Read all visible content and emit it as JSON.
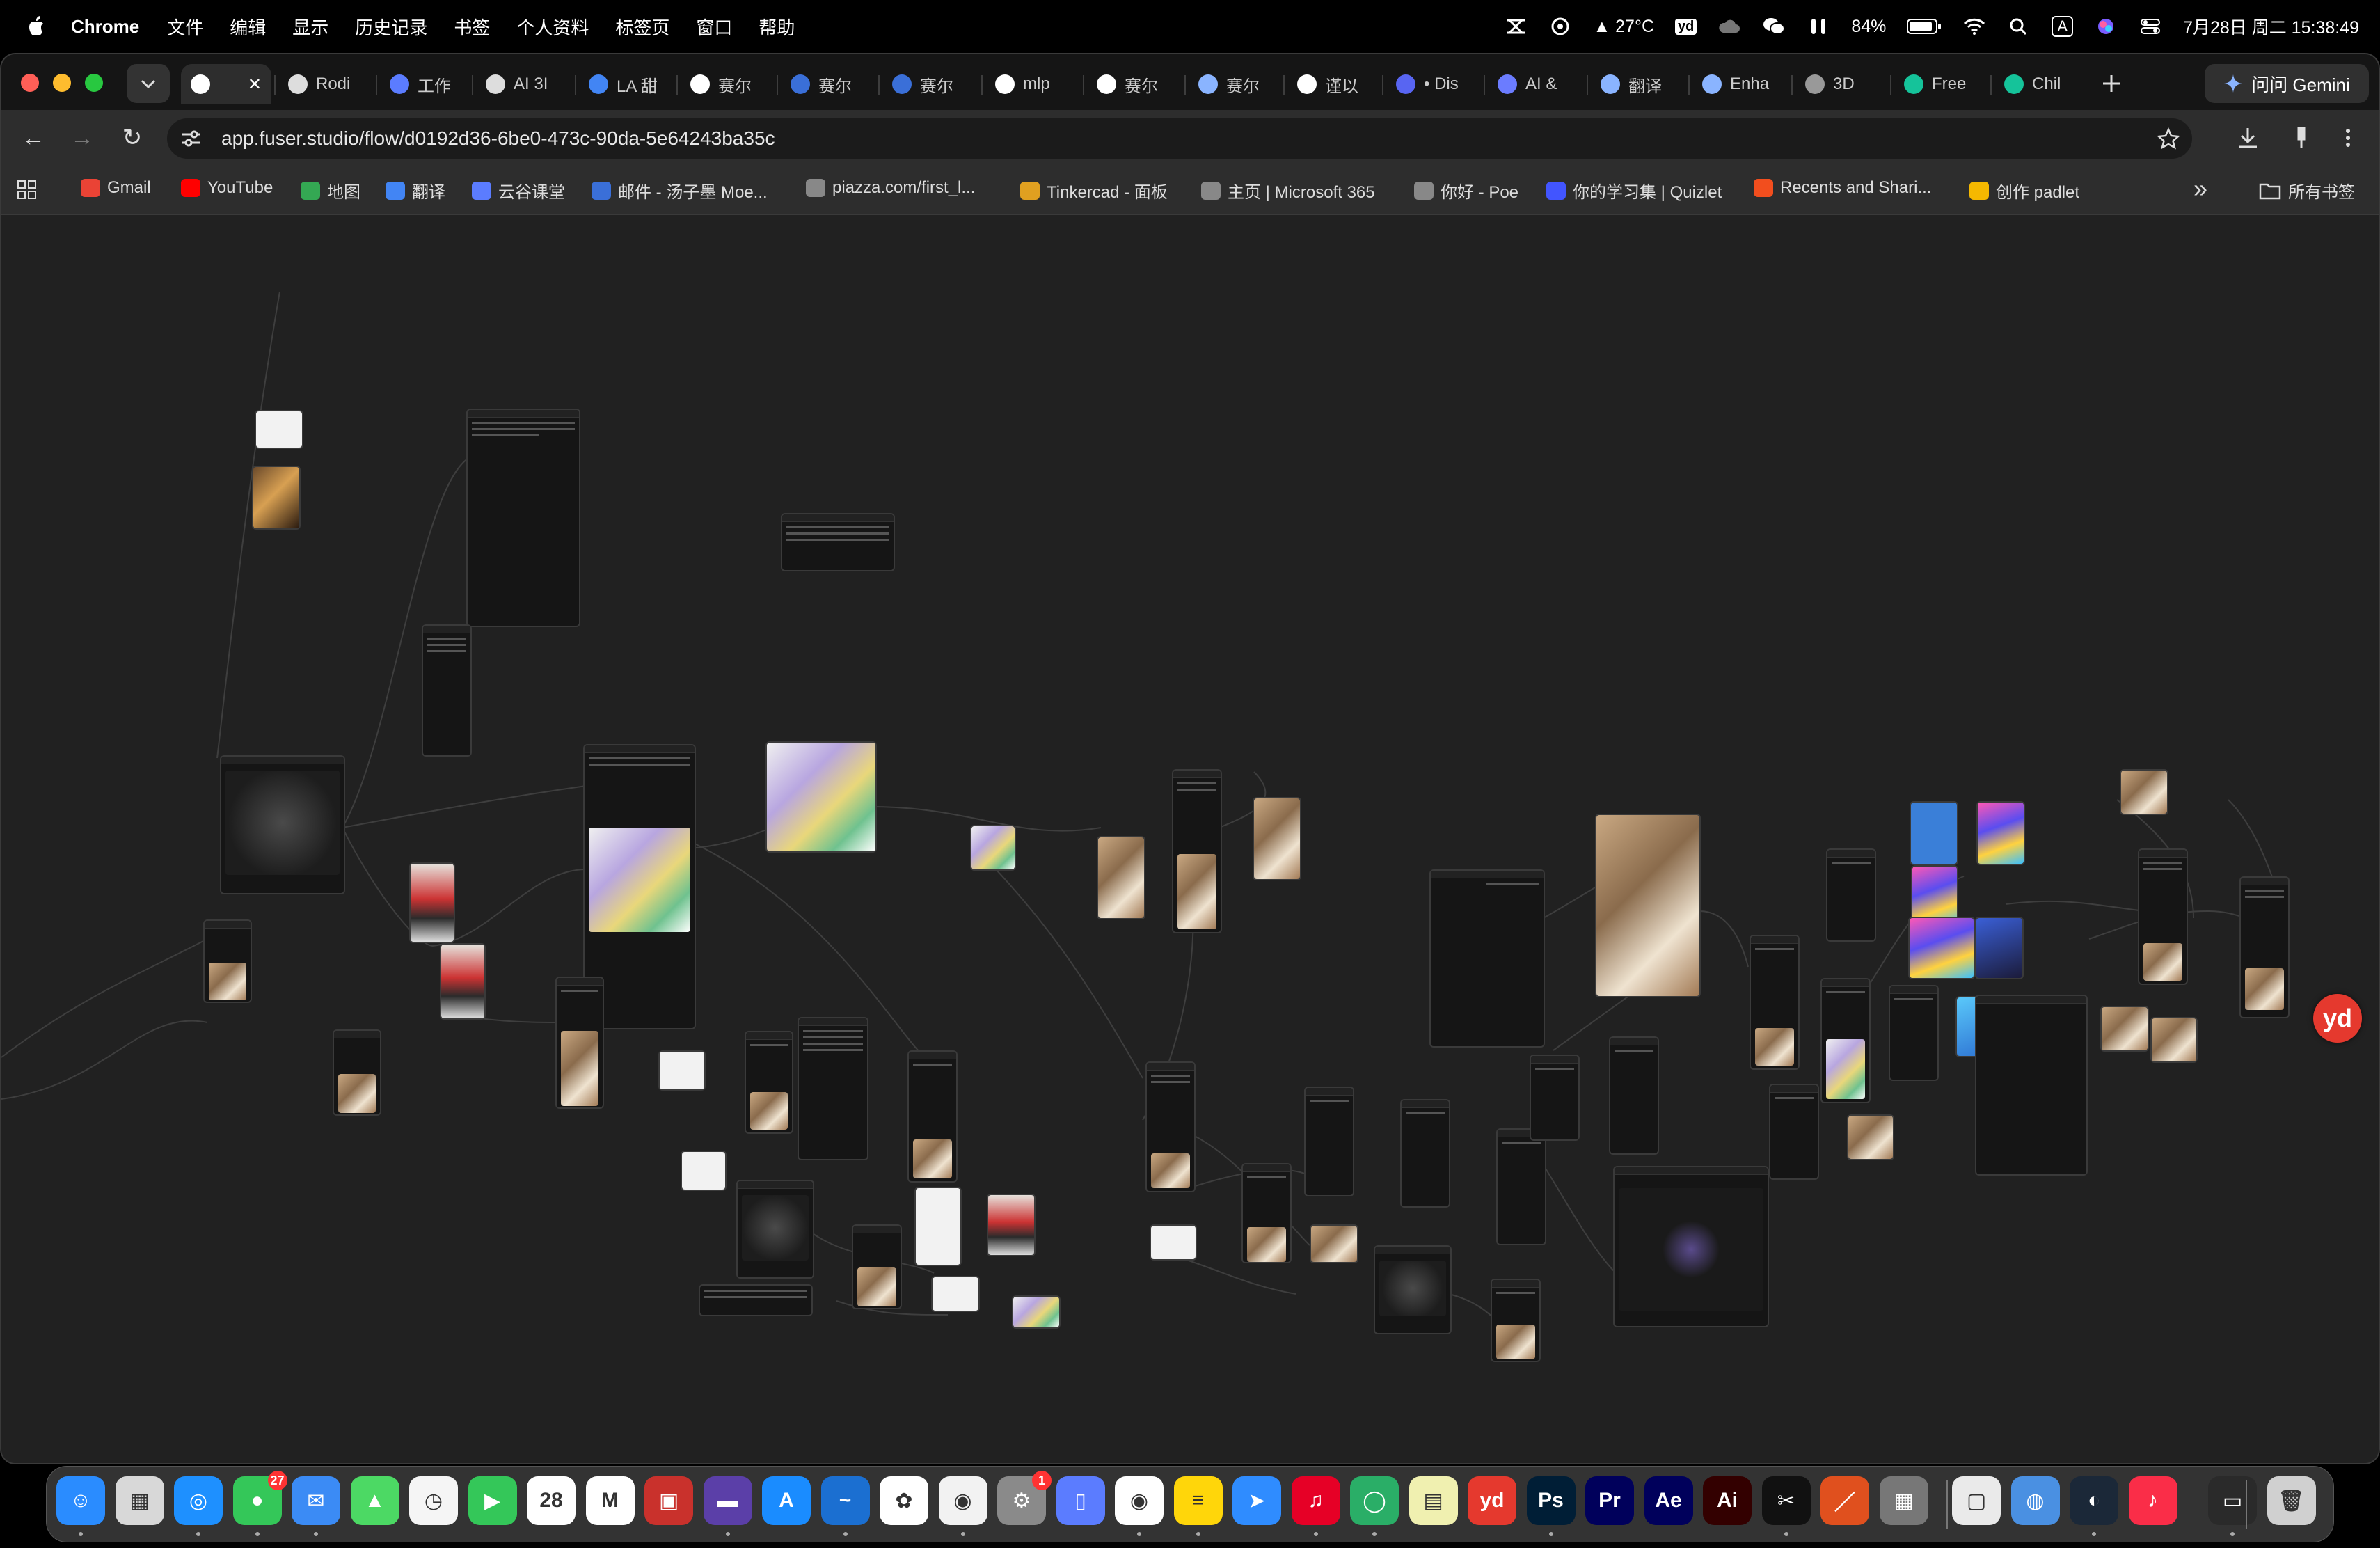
{
  "menubar": {
    "app_name": "Chrome",
    "items": [
      "文件",
      "编辑",
      "显示",
      "历史记录",
      "书签",
      "个人资料",
      "标签页",
      "窗口",
      "帮助"
    ],
    "weather": "27°C",
    "battery": "84%",
    "input_method": "A",
    "datetime": "7月28日 周二 15:38:49"
  },
  "tabs": [
    {
      "label": "",
      "icon": "fuser-icon",
      "active": true
    },
    {
      "label": "Rodi",
      "icon": "rodin-icon"
    },
    {
      "label": "工作",
      "icon": "work-icon"
    },
    {
      "label": "AI 3I",
      "icon": "ai-icon"
    },
    {
      "label": "LA 甜",
      "icon": "chrome-icon"
    },
    {
      "label": "赛尔",
      "icon": "google-icon"
    },
    {
      "label": "赛尔",
      "icon": "baidu-icon"
    },
    {
      "label": "赛尔",
      "icon": "baidu-icon"
    },
    {
      "label": "mlp",
      "icon": "google-icon"
    },
    {
      "label": "赛尔",
      "icon": "google-icon"
    },
    {
      "label": "赛尔",
      "icon": "gemini-icon"
    },
    {
      "label": "谨以",
      "icon": "google-icon"
    },
    {
      "label": "• Dis",
      "icon": "discord-icon"
    },
    {
      "label": "AI &",
      "icon": "app-icon"
    },
    {
      "label": "翻译",
      "icon": "gemini-icon"
    },
    {
      "label": "Enha",
      "icon": "gemini-icon"
    },
    {
      "label": "3D",
      "icon": "globe-icon"
    },
    {
      "label": "Free",
      "icon": "grammarly-icon"
    },
    {
      "label": "Chil",
      "icon": "grammarly-icon"
    }
  ],
  "gemini_button": "问问 Gemini",
  "address": {
    "url": "app.fuser.studio/flow/d0192d36-6be0-473c-90da-5e64243ba35c"
  },
  "bookmarks": [
    {
      "label": "Gmail",
      "color": "#ea4335"
    },
    {
      "label": "YouTube",
      "color": "#ff0000"
    },
    {
      "label": "地图",
      "color": "#34a853"
    },
    {
      "label": "翻译",
      "color": "#4285f4"
    },
    {
      "label": "云谷课堂",
      "color": "#5b7cff"
    },
    {
      "label": "邮件 - 汤子墨 Moe...",
      "color": "#3a6fd8"
    },
    {
      "label": "piazza.com/first_l...",
      "color": "#888888"
    },
    {
      "label": "Tinkercad - 面板",
      "color": "#e0a020"
    },
    {
      "label": "主页 | Microsoft 365",
      "color": "#888888"
    },
    {
      "label": "你好 - Poe",
      "color": "#888888"
    },
    {
      "label": "你的学习集 | Quizlet",
      "color": "#4255ff"
    },
    {
      "label": "Recents and Shari...",
      "color": "#f24e1e"
    },
    {
      "label": "创作 padlet",
      "color": "#f5b800"
    }
  ],
  "bookmarks_overflow": "»",
  "all_bookmarks": "所有书签",
  "dock": {
    "apps": [
      {
        "name": "finder",
        "color": "#2a8cff",
        "glyph": "☺"
      },
      {
        "name": "launchpad",
        "color": "#d8d8d8",
        "glyph": "▦"
      },
      {
        "name": "safari",
        "color": "#1e90ff",
        "glyph": "◎"
      },
      {
        "name": "messages",
        "color": "#34c759",
        "glyph": "●",
        "badge": "27"
      },
      {
        "name": "mail",
        "color": "#3b8bf5",
        "glyph": "✉"
      },
      {
        "name": "maps",
        "color": "#4cd964",
        "glyph": "▲"
      },
      {
        "name": "clock",
        "color": "#f5f5f5",
        "glyph": "◷"
      },
      {
        "name": "facetime",
        "color": "#34c759",
        "glyph": "▶"
      },
      {
        "name": "calendar",
        "color": "#ffffff",
        "glyph": "28"
      },
      {
        "name": "gmail",
        "color": "#ffffff",
        "glyph": "M"
      },
      {
        "name": "photo-booth",
        "color": "#c9312c",
        "glyph": "▣"
      },
      {
        "name": "screen-app",
        "color": "#5b3fa8",
        "glyph": "▬"
      },
      {
        "name": "app-store",
        "color": "#1a8cff",
        "glyph": "A"
      },
      {
        "name": "freeform",
        "color": "#1b6fd1",
        "glyph": "~"
      },
      {
        "name": "photos",
        "color": "#ffffff",
        "glyph": "✿"
      },
      {
        "name": "notification",
        "color": "#f2f2f2",
        "glyph": "◉"
      },
      {
        "name": "system-settings",
        "color": "#8a8a8a",
        "glyph": "⚙",
        "badge": "1"
      },
      {
        "name": "remote",
        "color": "#5b7cff",
        "glyph": "▯"
      },
      {
        "name": "chrome",
        "color": "#ffffff",
        "glyph": "◉"
      },
      {
        "name": "notes",
        "color": "#ffd60a",
        "glyph": "≡"
      },
      {
        "name": "paper-plane",
        "color": "#2f8cff",
        "glyph": "➤"
      },
      {
        "name": "netease-music",
        "color": "#e60026",
        "glyph": "♫"
      },
      {
        "name": "wechat",
        "color": "#2aae67",
        "glyph": "◯"
      },
      {
        "name": "notebook",
        "color": "#f0f0b0",
        "glyph": "▤"
      },
      {
        "name": "youdao",
        "color": "#e5392e",
        "glyph": "yd"
      },
      {
        "name": "photoshop",
        "color": "#001e36",
        "glyph": "Ps"
      },
      {
        "name": "premiere",
        "color": "#00005b",
        "glyph": "Pr"
      },
      {
        "name": "after-effects",
        "color": "#00005b",
        "glyph": "Ae"
      },
      {
        "name": "illustrator",
        "color": "#330000",
        "glyph": "Ai"
      },
      {
        "name": "capcut",
        "color": "#111111",
        "glyph": "✂"
      },
      {
        "name": "pen-app",
        "color": "#e0501e",
        "glyph": "／"
      },
      {
        "name": "calculator",
        "color": "#777777",
        "glyph": "▦"
      },
      {
        "name": "window-app",
        "color": "#eaeaea",
        "glyph": "▢"
      },
      {
        "name": "disk-app",
        "color": "#4a90e2",
        "glyph": "◍"
      },
      {
        "name": "steam",
        "color": "#1b2838",
        "glyph": "◐"
      },
      {
        "name": "music",
        "color": "#fa2d48",
        "glyph": "♪"
      },
      {
        "name": "desktop-folder",
        "color": "#2a2a2a",
        "glyph": "▭"
      },
      {
        "name": "trash",
        "color": "#d0d0d0",
        "glyph": "🗑"
      }
    ]
  },
  "floating_button": "yd"
}
